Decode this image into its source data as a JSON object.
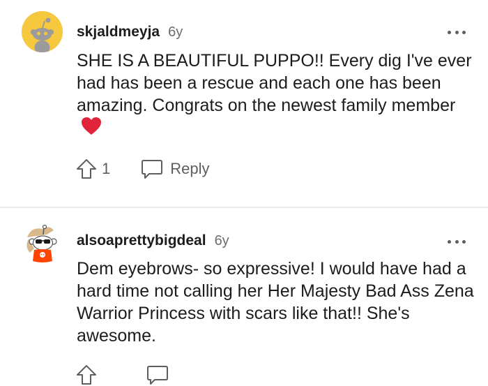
{
  "comments": [
    {
      "username": "skjaldmeyja",
      "age": "6y",
      "body": "SHE IS A BEAUTIFUL PUPPO!! Every dig I've ever had has been a rescue and each one has been amazing. Congrats on the newest family member",
      "emoji": "heart",
      "votes": "1",
      "reply_label": "Reply",
      "avatar_icon": "snoo-avatar-icon",
      "avatar_color": "#f5c83e"
    },
    {
      "username": "alsoaprettybigdeal",
      "age": "6y",
      "body": "Dem eyebrows- so expressive! I would have had a hard time not calling her Her Majesty Bad Ass Zena Warrior Princess with scars like that!! She's awesome.",
      "avatar_icon": "snoo-sunglasses-avatar-icon"
    }
  ],
  "colors": {
    "text": "#1c1c1c",
    "meta": "#6a6d6f",
    "icon": "#5c5f61",
    "divider": "#e9ebed",
    "heart": "#e0243a"
  }
}
